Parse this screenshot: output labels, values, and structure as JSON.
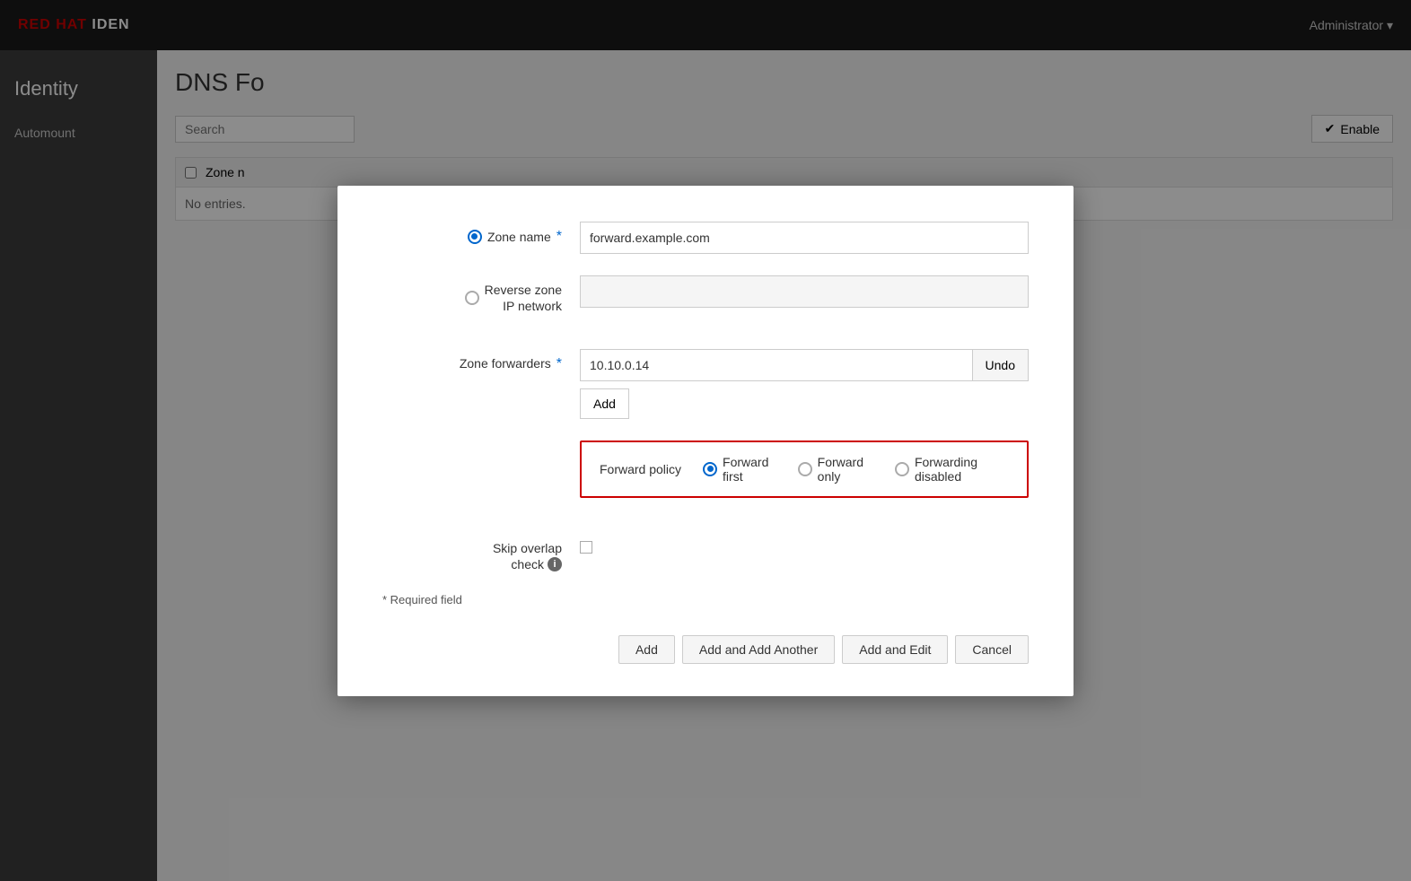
{
  "topNav": {
    "brand": "RED HAT IDEN",
    "adminLabel": "Administrator ▾"
  },
  "sidebar": {
    "identityLabel": "Identity",
    "automountLabel": "Automount"
  },
  "mainPage": {
    "title": "DNS Fo",
    "searchPlaceholder": "Search",
    "enableButtonLabel": "Enable",
    "tableHeaderZoneLabel": "Zone n",
    "tableNoEntries": "No entries."
  },
  "dialog": {
    "zoneNameLabel": "Zone name",
    "zoneNameRequired": true,
    "zoneNameValue": "forward.example.com",
    "reverseZoneLabel1": "Reverse zone",
    "reverseZoneLabel2": "IP network",
    "reverseZoneValue": "",
    "zoneForwardersLabel": "Zone forwarders",
    "zoneForwardersRequired": true,
    "zoneForwardersValue": "10.10.0.14",
    "undoButtonLabel": "Undo",
    "addForwarderButtonLabel": "Add",
    "forwardPolicyLabel": "Forward policy",
    "forwardPolicyOptions": [
      {
        "value": "first",
        "label": "Forward first",
        "checked": true
      },
      {
        "value": "only",
        "label": "Forward only",
        "checked": false
      },
      {
        "value": "disabled",
        "label": "Forwarding disabled",
        "checked": false
      }
    ],
    "skipOverlapLabel1": "Skip overlap",
    "skipOverlapLabel2": "check",
    "skipOverlapChecked": false,
    "requiredNote": "* Required field",
    "buttons": {
      "add": "Add",
      "addAndAddAnother": "Add and Add Another",
      "addAndEdit": "Add and Edit",
      "cancel": "Cancel"
    }
  },
  "icons": {
    "checkmark": "✔",
    "info": "i"
  }
}
